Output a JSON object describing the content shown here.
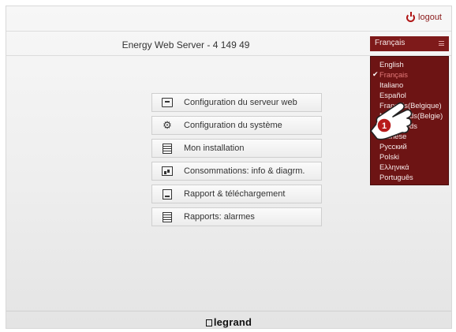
{
  "header": {
    "logout_label": "logout",
    "server_title": "Energy Web Server - 4 149 49"
  },
  "language": {
    "selected": "Français",
    "options": [
      "English",
      "Français",
      "Italiano",
      "Español",
      "Français(Belgique)",
      "Nederlands(Belgie)",
      "Nederlands",
      "Chinese",
      "Русский",
      "Polski",
      "Ελληνικά",
      "Português"
    ],
    "active_index": 1
  },
  "menu": {
    "items": [
      {
        "label": "Configuration du serveur web",
        "icon": "monitor-gear-icon"
      },
      {
        "label": "Configuration du système",
        "icon": "gears-icon"
      },
      {
        "label": "Mon installation",
        "icon": "installation-icon"
      },
      {
        "label": "Consommations: info & diagrm.",
        "icon": "chart-icon"
      },
      {
        "label": "Rapport & téléchargement",
        "icon": "download-report-icon"
      },
      {
        "label": "Rapports: alarmes",
        "icon": "alarm-report-icon"
      }
    ]
  },
  "callout": {
    "number": "1"
  },
  "footer": {
    "brand": "legrand"
  },
  "colors": {
    "accent": "#7e1a1a",
    "dropdown_bg": "#6d1414"
  }
}
